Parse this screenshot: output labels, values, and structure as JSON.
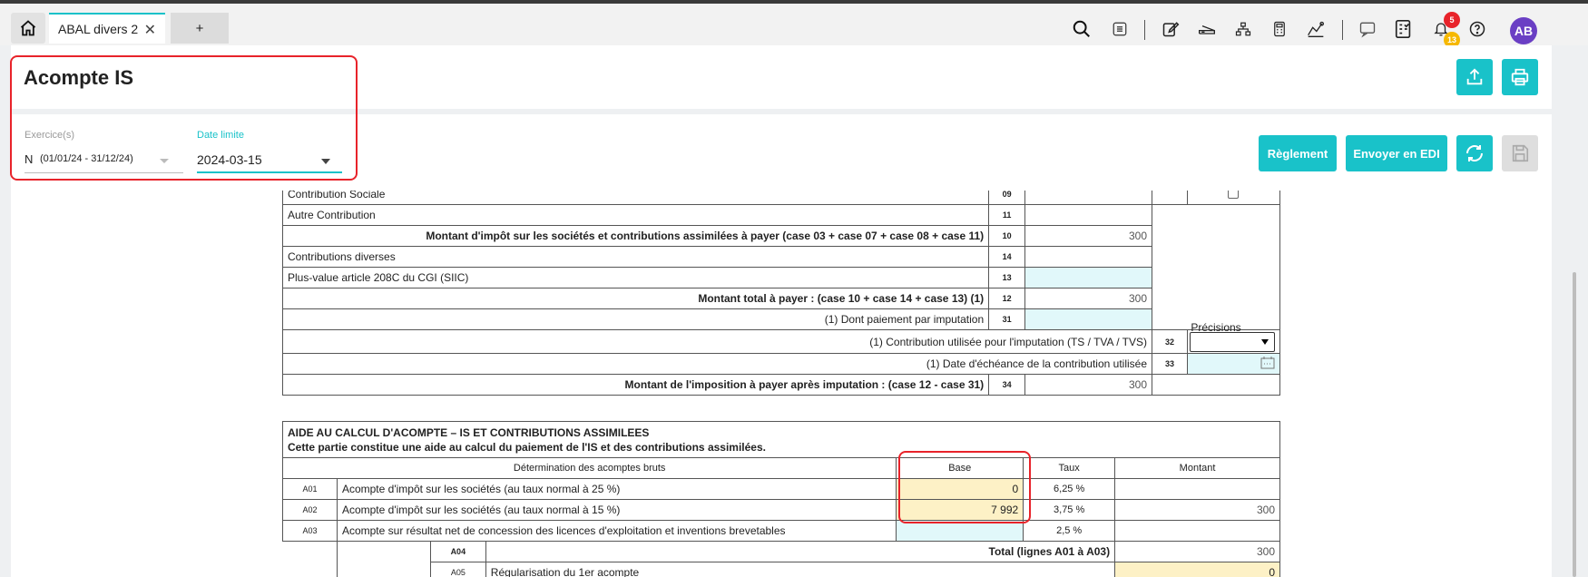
{
  "tabs": {
    "current_label": "ABAL divers 2",
    "add_label": "+"
  },
  "notifications": {
    "count_primary": "5",
    "count_secondary": "13"
  },
  "user": {
    "initials": "AB"
  },
  "page": {
    "title": "Acompte IS"
  },
  "filters": {
    "exercice_label": "Exercice(s)",
    "exercice_value_prefix": "N",
    "exercice_value": "(01/01/24 - 31/12/24)",
    "date_label": "Date limite",
    "date_value": "2024-03-15"
  },
  "actions": {
    "reglement_label": "Règlement",
    "edi_label": "Envoyer en EDI"
  },
  "colors": {
    "accent": "#19c2c9",
    "highlight": "#e8232a",
    "input_cyan": "#e1f8fa",
    "input_yellow": "#fdf1c6",
    "avatar": "#6a3fc4",
    "badge_red": "#e8232a",
    "badge_yellow": "#f6b800"
  },
  "form_top": {
    "partial_row": {
      "label": "Contribution Sociale",
      "num": "09"
    },
    "rows": [
      {
        "label": "Autre Contribution",
        "num": "11",
        "value": ""
      },
      {
        "label": "Montant d'impôt sur les sociétés et contributions assimilées à payer (case 03 + case 07 + case 08 + case 11)",
        "num": "10",
        "value": "300"
      },
      {
        "label": "Contributions diverses",
        "num": "14",
        "value": ""
      },
      {
        "label": "Plus-value article 208C du CGI (SIIC)",
        "num": "13",
        "value": ""
      },
      {
        "label": "Montant total à payer : (case 10 + case 14 + case 13) (1)",
        "num": "12",
        "value": "300"
      },
      {
        "label": "(1) Dont paiement par imputation",
        "num": "31",
        "value": ""
      }
    ],
    "precisions_label": "Précisions",
    "row32": {
      "label": "(1) Contribution utilisée pour l'imputation (TS / TVA / TVS)",
      "num": "32"
    },
    "row33": {
      "label": "(1) Date d'échéance de la contribution utilisée",
      "num": "33"
    },
    "row34": {
      "label": "Montant de l'imposition à payer après imputation : (case 12 - case 31)",
      "num": "34",
      "value": "300"
    }
  },
  "aide": {
    "title": "AIDE AU CALCUL D'ACOMPTE – IS ET CONTRIBUTIONS ASSIMILEES",
    "subtitle": "Cette partie constitue une aide au calcul du paiement de l'IS et des contributions assimilées.",
    "headers": {
      "determination": "Détermination des acomptes bruts",
      "base": "Base",
      "taux": "Taux",
      "montant": "Montant"
    },
    "rows": [
      {
        "code": "A01",
        "label": "Acompte d'impôt sur les sociétés (au taux normal à 25 %)",
        "base": "0",
        "taux": "6,25 %",
        "montant": ""
      },
      {
        "code": "A02",
        "label": "Acompte d'impôt sur les sociétés (au taux normal à 15 %)",
        "base": "7 992",
        "taux": "3,75 %",
        "montant": "300"
      },
      {
        "code": "A03",
        "label": "Acompte sur résultat net de concession des licences d'exploitation et inventions brevetables",
        "base": "",
        "taux": "2,5 %",
        "montant": ""
      }
    ],
    "total": {
      "code": "A04",
      "label": "Total (lignes A01 à A03)",
      "value": "300"
    },
    "partial_row": {
      "code": "A05",
      "label": "Régularisation du 1er acompte",
      "value": "0"
    }
  }
}
